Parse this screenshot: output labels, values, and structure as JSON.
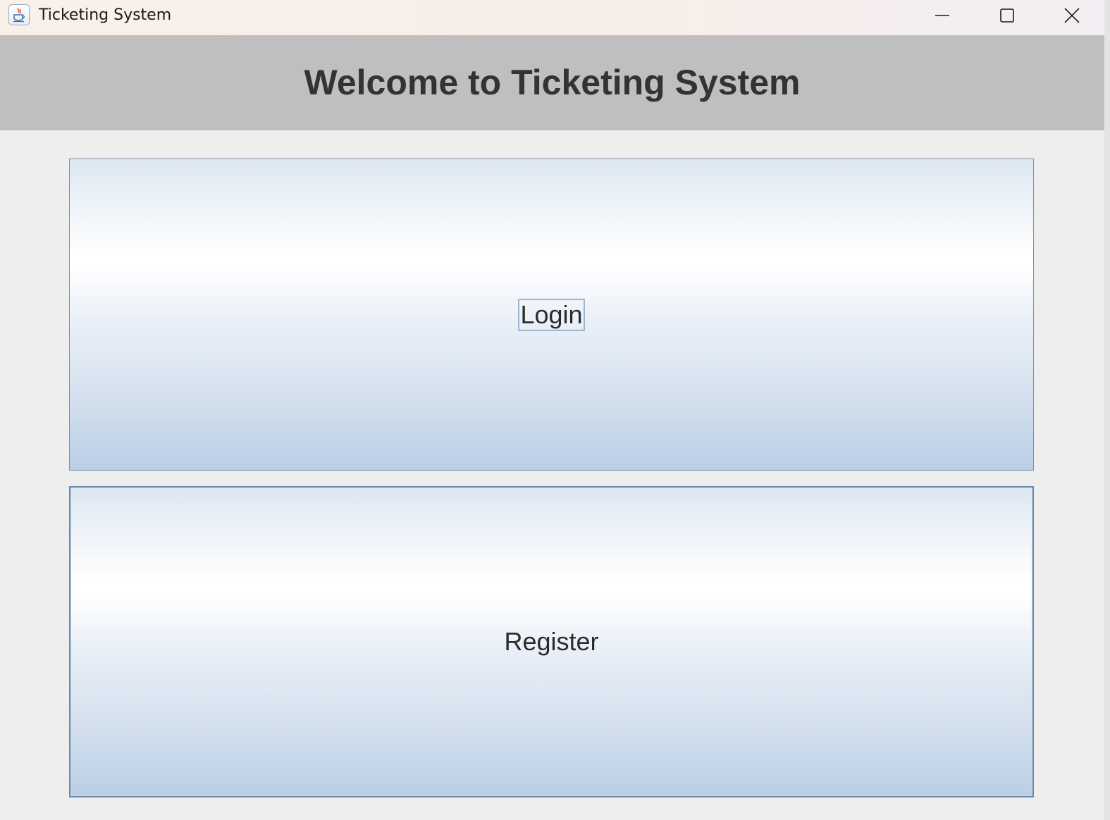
{
  "window": {
    "title": "Ticketing System",
    "app_icon": "java-coffee-cup-icon",
    "controls": {
      "minimize": "minimize-icon",
      "maximize": "maximize-icon",
      "close": "close-icon"
    }
  },
  "header": {
    "title": "Welcome to Ticketing System"
  },
  "buttons": {
    "login_label": "Login",
    "register_label": "Register"
  },
  "colors": {
    "header_bg": "#bfbfbf",
    "content_bg": "#eeeeee",
    "button_top": "#dde7f2",
    "button_bottom": "#b9cee6",
    "button_border": "#7a8ea8",
    "text": "#333333"
  }
}
